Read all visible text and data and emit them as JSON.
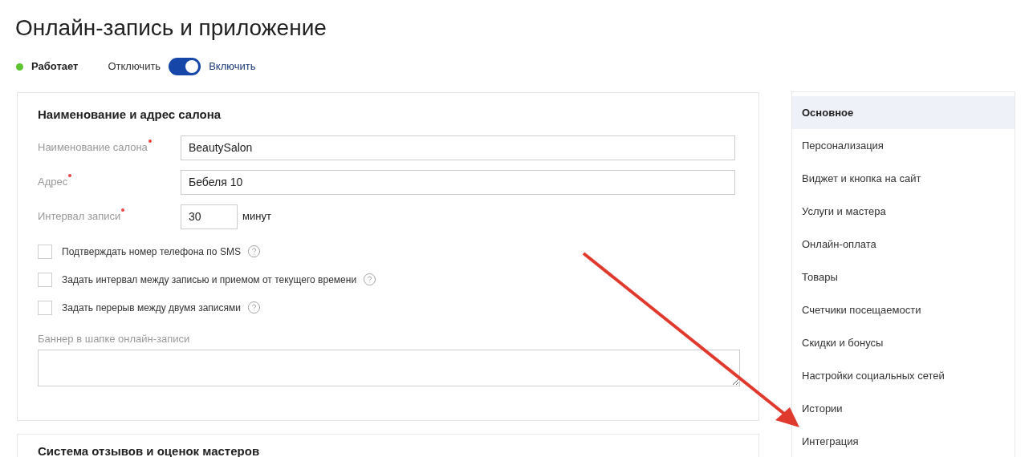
{
  "page": {
    "title": "Онлайн-запись и приложение"
  },
  "status": {
    "label": "Работает",
    "running": true
  },
  "toggle": {
    "off_label": "Отключить",
    "on_label": "Включить",
    "on": true
  },
  "cards": [
    {
      "title": "Наименование и адрес салона",
      "fields": [
        {
          "label": "Наименование салона",
          "required": true,
          "value": "BeautySalon",
          "kind": "wide"
        },
        {
          "label": "Адрес",
          "required": true,
          "value": "Бебеля 10",
          "kind": "wide"
        },
        {
          "label": "Интервал записи",
          "required": true,
          "value": "30",
          "suffix": "минут",
          "kind": "short"
        }
      ],
      "checkboxes": [
        {
          "label": "Подтверждать номер телефона по SMS",
          "checked": false
        },
        {
          "label": "Задать интервал между записью и приемом от текущего времени",
          "checked": false
        },
        {
          "label": "Задать перерыв между двумя записями",
          "checked": false
        }
      ],
      "banner": {
        "label": "Баннер в шапке онлайн-записи"
      }
    },
    {
      "title": "Система отзывов и оценок мастеров"
    }
  ],
  "nav": {
    "items": [
      {
        "label": "Основное",
        "selected": true
      },
      {
        "label": "Персонализация",
        "selected": false
      },
      {
        "label": "Виджет и кнопка на сайт",
        "selected": false
      },
      {
        "label": "Услуги и мастера",
        "selected": false
      },
      {
        "label": "Онлайн-оплата",
        "selected": false
      },
      {
        "label": "Товары",
        "selected": false
      },
      {
        "label": "Счетчики посещаемости",
        "selected": false
      },
      {
        "label": "Скидки и бонусы",
        "selected": false
      },
      {
        "label": "Настройки социальных сетей",
        "selected": false
      },
      {
        "label": "Истории",
        "selected": false
      },
      {
        "label": "Интеграция",
        "selected": false
      }
    ]
  }
}
